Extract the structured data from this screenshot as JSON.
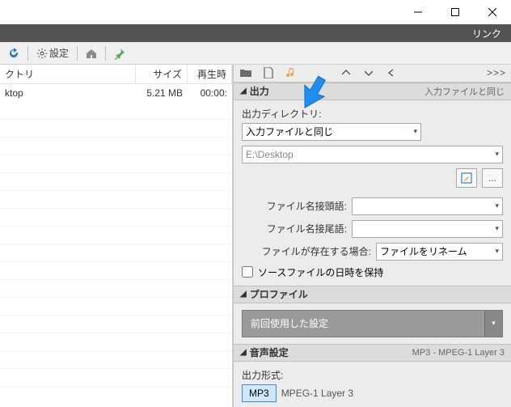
{
  "linkbar": {
    "label": "リンク"
  },
  "toolbar": {
    "settings": "設定"
  },
  "filelist": {
    "headers": {
      "dir": "クトリ",
      "size": "サイズ",
      "play": "再生時"
    },
    "rows": [
      {
        "dir": "ktop",
        "size": "5.21 MB",
        "play": "00:00:"
      }
    ]
  },
  "panel_tb": {
    "more": ">>>"
  },
  "output": {
    "title": "出力",
    "right": "入力ファイルと同じ",
    "outdir_label": "出力ディレクトリ:",
    "outdir_value": "入力ファイルと同じ",
    "path": "E:\\Desktop",
    "prefix_label": "ファイル名接頭語:",
    "suffix_label": "ファイル名接尾語:",
    "exists_label": "ファイルが存在する場合:",
    "exists_value": "ファイルをリネーム",
    "keep_time": "ソースファイルの日時を保持"
  },
  "profile": {
    "title": "プロファイル",
    "value": "前回使用した設定"
  },
  "audio": {
    "title": "音声設定",
    "right": "MP3 - MPEG-1 Layer 3",
    "format_label": "出力形式:",
    "format_btn": "MP3",
    "format_desc": "MPEG-1 Layer 3"
  }
}
